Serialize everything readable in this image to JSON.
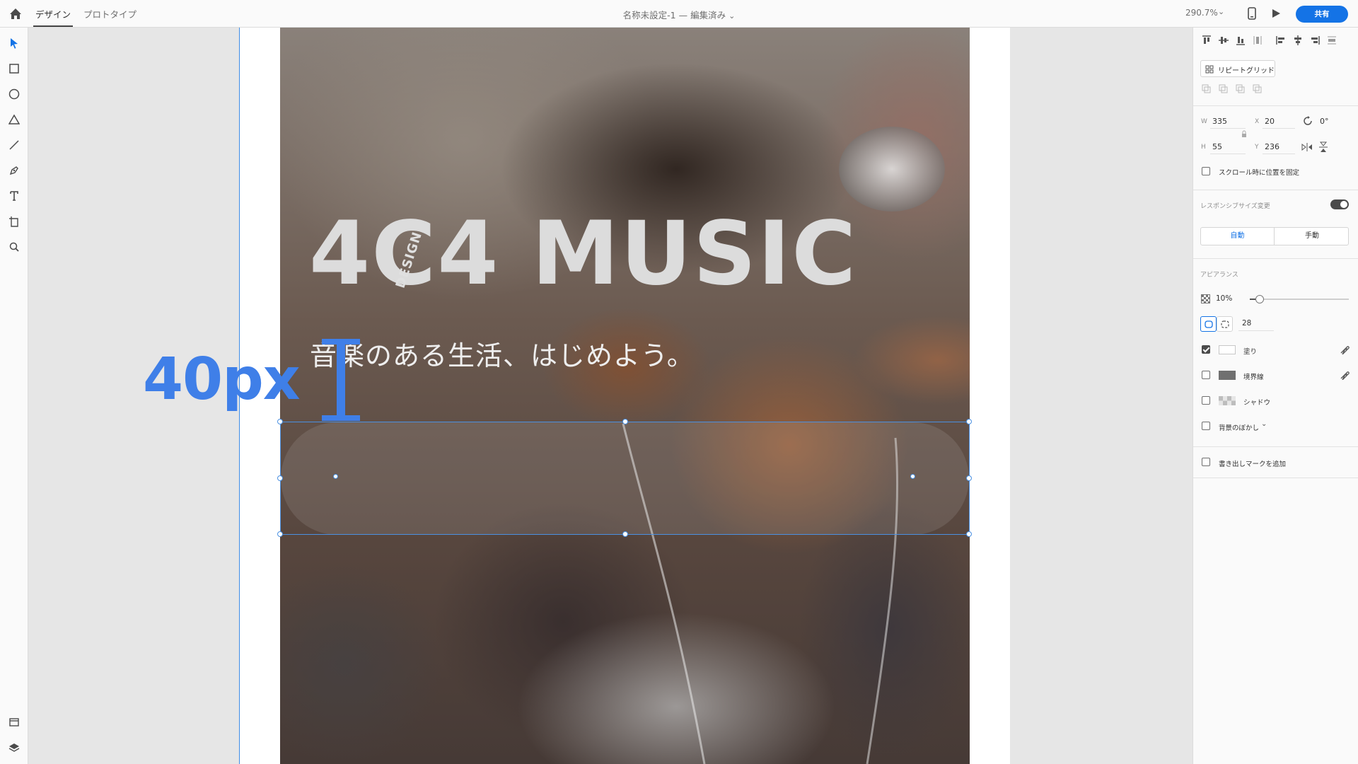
{
  "topbar": {
    "tab_design": "デザイン",
    "tab_prototype": "プロトタイプ",
    "doc_name": "名称未設定-1",
    "doc_separator": "—",
    "doc_status": "編集済み",
    "zoom": "290.7%",
    "share_label": "共有"
  },
  "toolbar": {
    "tools": [
      "select-icon",
      "rectangle-icon",
      "ellipse-icon",
      "polygon-icon",
      "line-icon",
      "pen-icon",
      "text-icon",
      "artboard-icon",
      "zoom-icon"
    ],
    "bottom": [
      "assets-icon",
      "layers-icon"
    ]
  },
  "canvas": {
    "logo_text": "4C4 MUSIC",
    "logo_subtext": "DESIGN",
    "tagline": "音楽のある生活、はじめよう。",
    "annotation": "40px",
    "annotation_color": "#3f7fe8",
    "selection_color": "#4a90e2"
  },
  "panel": {
    "repeat_grid_label": "リピートグリッド",
    "w_label": "W",
    "w_value": "335",
    "x_label": "X",
    "x_value": "20",
    "rotation_value": "0°",
    "h_label": "H",
    "h_value": "55",
    "y_label": "Y",
    "y_value": "236",
    "fix_scroll_label": "スクロール時に位置を固定",
    "responsive_label": "レスポンシブサイズ変更",
    "responsive_on": true,
    "auto_label": "自動",
    "manual_label": "手動",
    "appearance_label": "アピアランス",
    "opacity_value": "10%",
    "opacity_fraction": 0.1,
    "corner_radius": "28",
    "fill_label": "塗り",
    "fill_checked": true,
    "fill_color": "#ffffff",
    "border_label": "境界線",
    "border_color": "#707070",
    "shadow_label": "シャドウ",
    "bg_blur_label": "背景のぼかし",
    "export_label": "書き出しマークを追加"
  }
}
